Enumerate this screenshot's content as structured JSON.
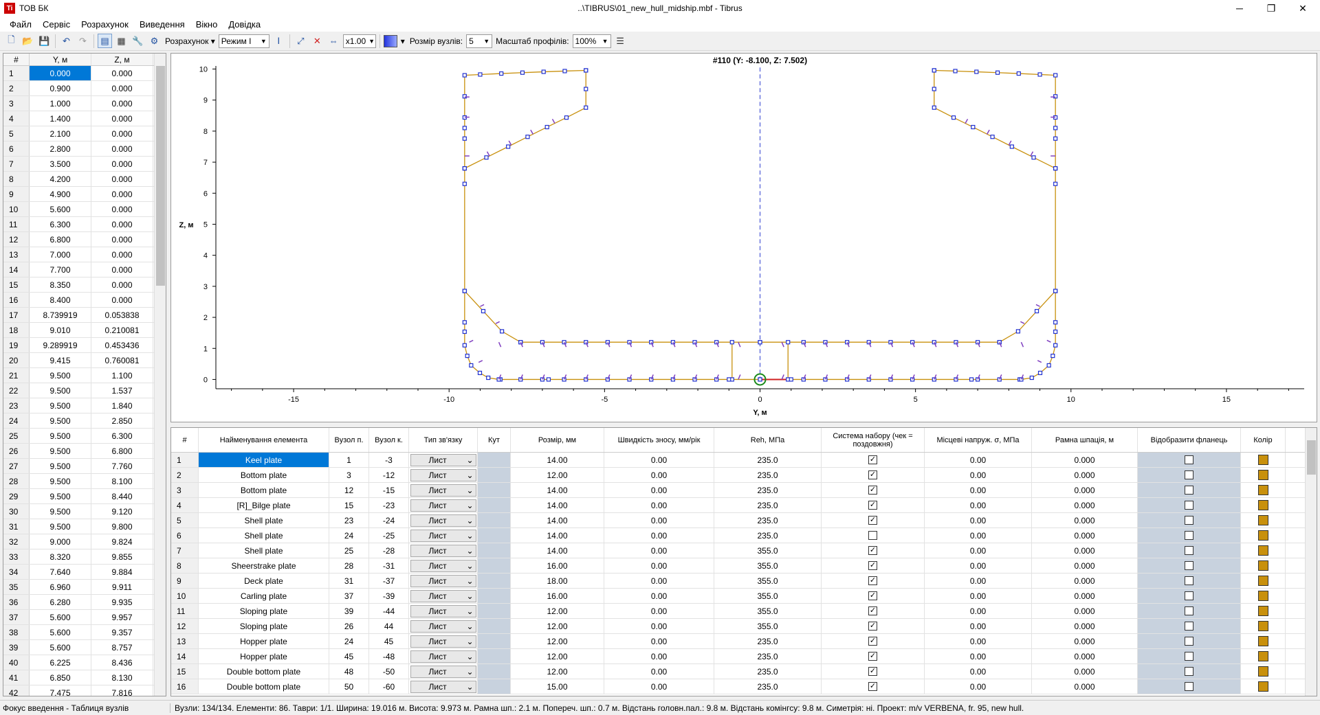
{
  "window": {
    "company": "ТОВ БК",
    "title": "..\\TIBRUS\\01_new_hull_midship.mbf - Tibrus",
    "minimize": "─",
    "maximize": "❐",
    "close": "✕"
  },
  "menu": [
    "Файл",
    "Сервіс",
    "Розрахунок",
    "Виведення",
    "Вікно",
    "Довідка"
  ],
  "toolbar": {
    "calc_label": "Розрахунок",
    "mode_value": "Режим I",
    "zoom_value": "x1.00",
    "node_size_label": "Розмір вузлів:",
    "node_size_value": "5",
    "profile_scale_label": "Масштаб профілів:",
    "profile_scale_value": "100%"
  },
  "node_table": {
    "headers": [
      "#",
      "Y, м",
      "Z, м"
    ],
    "rows": [
      [
        "1",
        "0.000",
        "0.000"
      ],
      [
        "2",
        "0.900",
        "0.000"
      ],
      [
        "3",
        "1.000",
        "0.000"
      ],
      [
        "4",
        "1.400",
        "0.000"
      ],
      [
        "5",
        "2.100",
        "0.000"
      ],
      [
        "6",
        "2.800",
        "0.000"
      ],
      [
        "7",
        "3.500",
        "0.000"
      ],
      [
        "8",
        "4.200",
        "0.000"
      ],
      [
        "9",
        "4.900",
        "0.000"
      ],
      [
        "10",
        "5.600",
        "0.000"
      ],
      [
        "11",
        "6.300",
        "0.000"
      ],
      [
        "12",
        "6.800",
        "0.000"
      ],
      [
        "13",
        "7.000",
        "0.000"
      ],
      [
        "14",
        "7.700",
        "0.000"
      ],
      [
        "15",
        "8.350",
        "0.000"
      ],
      [
        "16",
        "8.400",
        "0.000"
      ],
      [
        "17",
        "8.739919",
        "0.053838"
      ],
      [
        "18",
        "9.010",
        "0.210081"
      ],
      [
        "19",
        "9.289919",
        "0.453436"
      ],
      [
        "20",
        "9.415",
        "0.760081"
      ],
      [
        "21",
        "9.500",
        "1.100"
      ],
      [
        "22",
        "9.500",
        "1.537"
      ],
      [
        "23",
        "9.500",
        "1.840"
      ],
      [
        "24",
        "9.500",
        "2.850"
      ],
      [
        "25",
        "9.500",
        "6.300"
      ],
      [
        "26",
        "9.500",
        "6.800"
      ],
      [
        "27",
        "9.500",
        "7.760"
      ],
      [
        "28",
        "9.500",
        "8.100"
      ],
      [
        "29",
        "9.500",
        "8.440"
      ],
      [
        "30",
        "9.500",
        "9.120"
      ],
      [
        "31",
        "9.500",
        "9.800"
      ],
      [
        "32",
        "9.000",
        "9.824"
      ],
      [
        "33",
        "8.320",
        "9.855"
      ],
      [
        "34",
        "7.640",
        "9.884"
      ],
      [
        "35",
        "6.960",
        "9.911"
      ],
      [
        "36",
        "6.280",
        "9.935"
      ],
      [
        "37",
        "5.600",
        "9.957"
      ],
      [
        "38",
        "5.600",
        "9.357"
      ],
      [
        "39",
        "5.600",
        "8.757"
      ],
      [
        "40",
        "6.225",
        "8.436"
      ],
      [
        "41",
        "6.850",
        "8.130"
      ],
      [
        "42",
        "7.475",
        "7.816"
      ]
    ]
  },
  "plot": {
    "title": "#110 (Y: -8.100, Z: 7.502)",
    "xlabel": "Y, м",
    "ylabel": "Z, м",
    "xticks": [
      "-15",
      "-10",
      "-5",
      "0",
      "5",
      "10",
      "15"
    ],
    "yticks": [
      "0",
      "1",
      "2",
      "3",
      "4",
      "5",
      "6",
      "7",
      "8",
      "9",
      "10"
    ],
    "xlim": [
      -17.5,
      17.5
    ],
    "ylim": [
      -0.3,
      10.1
    ],
    "colors": {
      "plate": "#c8900c",
      "node": "#2030d0",
      "stiffener": "#8040c0",
      "centerline": "#3040d0",
      "selected": "#d02020",
      "marker": "#1a8a1a"
    }
  },
  "elem_table": {
    "headers": [
      "#",
      "Найменування елемента",
      "Вузол п.",
      "Вузол к.",
      "Тип зв'язку",
      "Кут",
      "Розмір, мм",
      "Швидкість зносу, мм/рік",
      "Reh, МПа",
      "Система набору (чек = поздовжня)",
      "Місцеві напруж. σ, МПа",
      "Рамна шпація, м",
      "Відобразити фланець",
      "Колір"
    ],
    "rows": [
      {
        "n": "1",
        "name": "Keel plate",
        "a": "1",
        "b": "-3",
        "type": "Лист",
        "size": "14.00",
        "wear": "0.00",
        "reh": "235.0",
        "long": true,
        "sigma": "0.00",
        "frame": "0.000",
        "flange": false
      },
      {
        "n": "2",
        "name": "Bottom plate",
        "a": "3",
        "b": "-12",
        "type": "Лист",
        "size": "12.00",
        "wear": "0.00",
        "reh": "235.0",
        "long": true,
        "sigma": "0.00",
        "frame": "0.000",
        "flange": false
      },
      {
        "n": "3",
        "name": "Bottom plate",
        "a": "12",
        "b": "-15",
        "type": "Лист",
        "size": "14.00",
        "wear": "0.00",
        "reh": "235.0",
        "long": true,
        "sigma": "0.00",
        "frame": "0.000",
        "flange": false
      },
      {
        "n": "4",
        "name": "[R]_Bilge plate",
        "a": "15",
        "b": "-23",
        "type": "Лист",
        "size": "14.00",
        "wear": "0.00",
        "reh": "235.0",
        "long": true,
        "sigma": "0.00",
        "frame": "0.000",
        "flange": false
      },
      {
        "n": "5",
        "name": "Shell plate",
        "a": "23",
        "b": "-24",
        "type": "Лист",
        "size": "14.00",
        "wear": "0.00",
        "reh": "235.0",
        "long": true,
        "sigma": "0.00",
        "frame": "0.000",
        "flange": false
      },
      {
        "n": "6",
        "name": "Shell plate",
        "a": "24",
        "b": "-25",
        "type": "Лист",
        "size": "14.00",
        "wear": "0.00",
        "reh": "235.0",
        "long": false,
        "sigma": "0.00",
        "frame": "0.000",
        "flange": false
      },
      {
        "n": "7",
        "name": "Shell plate",
        "a": "25",
        "b": "-28",
        "type": "Лист",
        "size": "14.00",
        "wear": "0.00",
        "reh": "355.0",
        "long": true,
        "sigma": "0.00",
        "frame": "0.000",
        "flange": false
      },
      {
        "n": "8",
        "name": "Sheerstrake plate",
        "a": "28",
        "b": "-31",
        "type": "Лист",
        "size": "16.00",
        "wear": "0.00",
        "reh": "355.0",
        "long": true,
        "sigma": "0.00",
        "frame": "0.000",
        "flange": false
      },
      {
        "n": "9",
        "name": "Deck plate",
        "a": "31",
        "b": "-37",
        "type": "Лист",
        "size": "18.00",
        "wear": "0.00",
        "reh": "355.0",
        "long": true,
        "sigma": "0.00",
        "frame": "0.000",
        "flange": false
      },
      {
        "n": "10",
        "name": "Carling plate",
        "a": "37",
        "b": "-39",
        "type": "Лист",
        "size": "16.00",
        "wear": "0.00",
        "reh": "355.0",
        "long": true,
        "sigma": "0.00",
        "frame": "0.000",
        "flange": false
      },
      {
        "n": "11",
        "name": "Sloping plate",
        "a": "39",
        "b": "-44",
        "type": "Лист",
        "size": "12.00",
        "wear": "0.00",
        "reh": "355.0",
        "long": true,
        "sigma": "0.00",
        "frame": "0.000",
        "flange": false
      },
      {
        "n": "12",
        "name": "Sloping plate",
        "a": "26",
        "b": "44",
        "type": "Лист",
        "size": "12.00",
        "wear": "0.00",
        "reh": "355.0",
        "long": true,
        "sigma": "0.00",
        "frame": "0.000",
        "flange": false
      },
      {
        "n": "13",
        "name": "Hopper plate",
        "a": "24",
        "b": "45",
        "type": "Лист",
        "size": "12.00",
        "wear": "0.00",
        "reh": "235.0",
        "long": true,
        "sigma": "0.00",
        "frame": "0.000",
        "flange": false
      },
      {
        "n": "14",
        "name": "Hopper plate",
        "a": "45",
        "b": "-48",
        "type": "Лист",
        "size": "12.00",
        "wear": "0.00",
        "reh": "235.0",
        "long": true,
        "sigma": "0.00",
        "frame": "0.000",
        "flange": false
      },
      {
        "n": "15",
        "name": "Double bottom plate",
        "a": "48",
        "b": "-50",
        "type": "Лист",
        "size": "12.00",
        "wear": "0.00",
        "reh": "235.0",
        "long": true,
        "sigma": "0.00",
        "frame": "0.000",
        "flange": false
      },
      {
        "n": "16",
        "name": "Double bottom plate",
        "a": "50",
        "b": "-60",
        "type": "Лист",
        "size": "15.00",
        "wear": "0.00",
        "reh": "235.0",
        "long": true,
        "sigma": "0.00",
        "frame": "0.000",
        "flange": false
      }
    ]
  },
  "status": {
    "left": "Фокус введення - Таблиця вузлів",
    "right": "Вузли: 134/134. Елементи: 86. Таври: 1/1. Ширина: 19.016 м. Висота: 9.973 м. Рамна шп.: 2.1 м. Попереч. шп.: 0.7 м. Відстань головн.пал.: 9.8 м. Відстань комінгсу: 9.8 м. Симетрія: ні. Проект: m/v VERBENA, fr. 95, new hull."
  }
}
